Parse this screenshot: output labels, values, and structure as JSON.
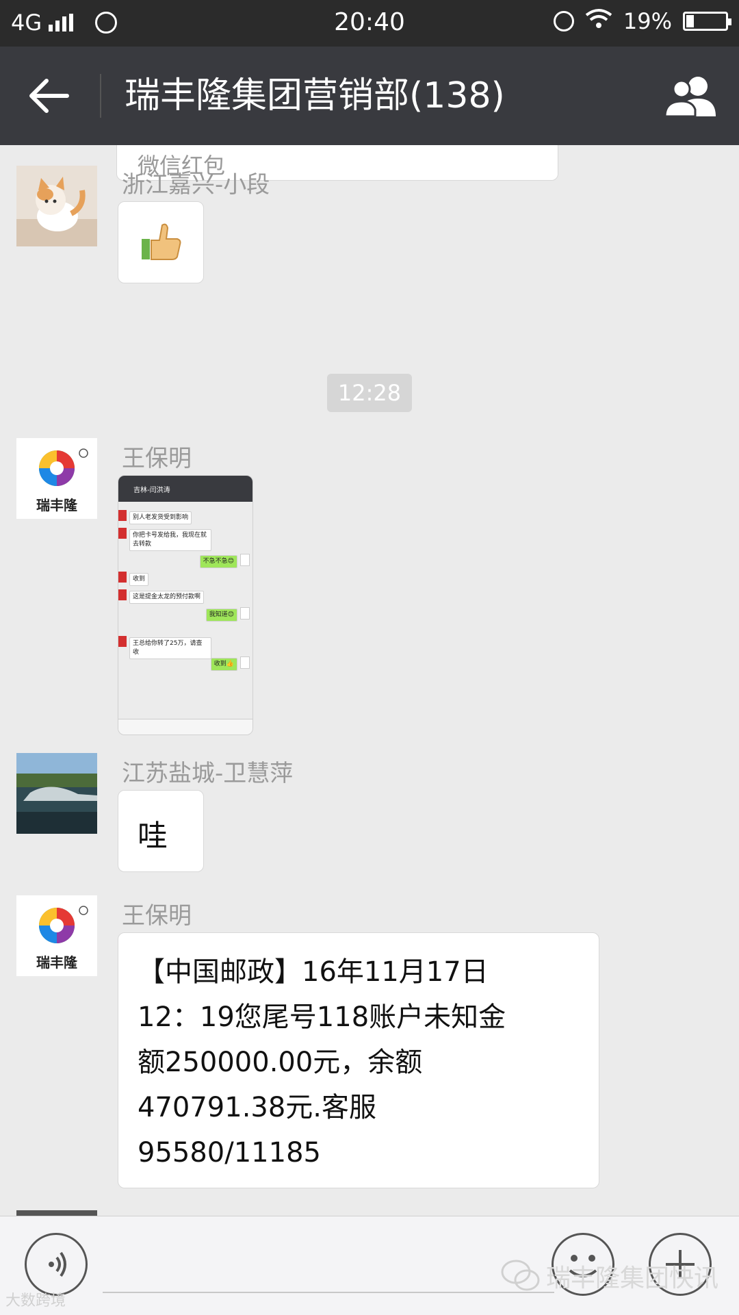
{
  "status_bar": {
    "network": "4G",
    "time": "20:40",
    "battery": "19%",
    "battery_level": 0.19
  },
  "nav": {
    "title": "瑞丰隆集团营销部(138)"
  },
  "chat": {
    "partial_bubble_text": "微信红包",
    "time_divider": "12:28",
    "messages": [
      {
        "sender": "浙江嘉兴-小段",
        "content": "thumbs-up emoji"
      },
      {
        "sender": "王保明",
        "avatar_text": "瑞丰隆",
        "content": "screenshot image"
      },
      {
        "sender": "江苏盐城-卫慧萍",
        "text": "哇"
      },
      {
        "sender": "王保明",
        "avatar_text": "瑞丰隆",
        "lines": [
          "【中国邮政】16年11月17日",
          "12：19您尾号118账户未知金",
          "额250000.00元，余额",
          "470791.38元.客服",
          "95580/11185"
        ]
      }
    ],
    "embedded_screenshot": {
      "title": "吉林-闫洪涛",
      "rows": [
        {
          "side": "left",
          "text": "别人老发货受到影响"
        },
        {
          "side": "left",
          "text": "你把卡号发给我，我现在就去转款"
        },
        {
          "side": "right",
          "text": "不急不急😊"
        },
        {
          "side": "left",
          "text": "收到"
        },
        {
          "side": "left",
          "text": "这是提金太龙的预付款啊"
        },
        {
          "side": "right",
          "text": "我知道😊"
        },
        {
          "side": "left",
          "text": "王总给你转了25万，请查收"
        },
        {
          "side": "right",
          "text": "收到👍"
        }
      ]
    }
  },
  "watermark": {
    "text": "瑞丰隆集团快讯",
    "corner": "大数跨境"
  },
  "icons": [
    "back-arrow-icon",
    "group-members-icon",
    "voice-icon",
    "emoji-icon",
    "plus-icon",
    "wechat-icon"
  ]
}
